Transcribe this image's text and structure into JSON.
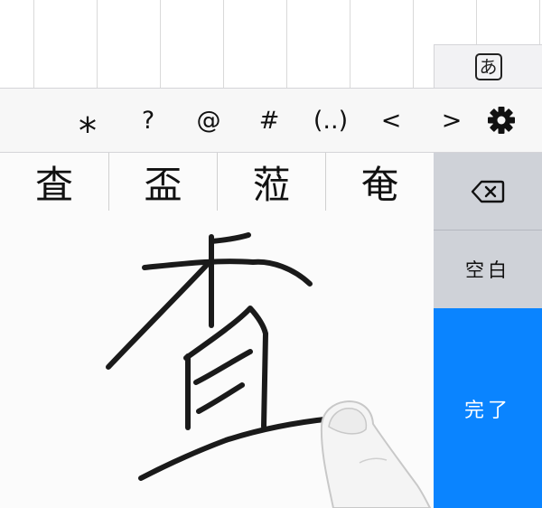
{
  "ime_toggle": {
    "label": "あ"
  },
  "toolbar": {
    "keys": [
      {
        "name": "asterisk-key",
        "label": "⁎"
      },
      {
        "name": "question-key",
        "label": "?"
      },
      {
        "name": "at-key",
        "label": "@"
      },
      {
        "name": "hash-key",
        "label": "#"
      },
      {
        "name": "ellipsis-key",
        "label": "(..)"
      },
      {
        "name": "less-than-key",
        "label": "<"
      },
      {
        "name": "greater-than-key",
        "label": ">"
      }
    ],
    "settings_icon": "gear-icon"
  },
  "candidates": [
    "査",
    "盃",
    "蒞",
    "奄"
  ],
  "side_keys": {
    "backspace_icon": "backspace-icon",
    "space_label": "空白",
    "done_label": "完了"
  },
  "colors": {
    "accent": "#0a84ff",
    "side_key_bg": "#cfd2d8",
    "stroke": "#1a1a1a"
  }
}
